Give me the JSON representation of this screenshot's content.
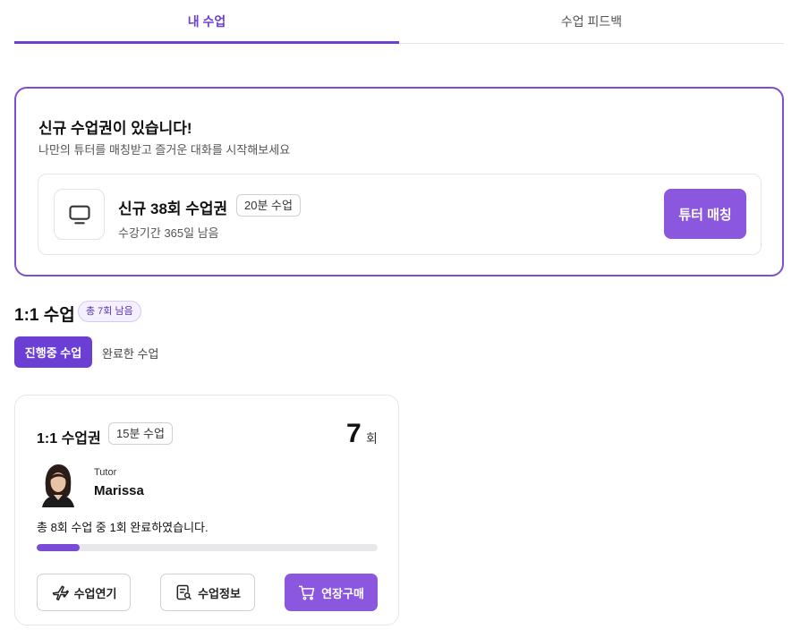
{
  "tabs": [
    {
      "label": "내 수업",
      "active": true
    },
    {
      "label": "수업 피드백",
      "active": false
    }
  ],
  "promo": {
    "title": "신규 수업권이 있습니다!",
    "subtitle": "나만의 튜터를 매칭받고 즐거운 대화를 시작해보세요",
    "ticket": {
      "icon": "monitor-icon",
      "title": "신규 38회 수업권",
      "badge": "20분 수업",
      "subtitle": "수강기간 365일 남음",
      "button": "튜터 매칭"
    }
  },
  "section": {
    "title": "1:1 수업",
    "badge": "총 7회 남음"
  },
  "segments": {
    "active": "진행중 수업",
    "inactive": "완료한 수업"
  },
  "card": {
    "title": "1:1 수업권",
    "badge": "15분 수업",
    "count": "7",
    "count_unit": "회",
    "tutor_label": "Tutor",
    "tutor_name": "Marissa",
    "progress_text": "총 8회 수업 중 1회 완료하였습니다.",
    "progress_fraction": 0.125,
    "buttons": [
      {
        "label": "수업연기",
        "icon": "airplane-icon"
      },
      {
        "label": "수업정보",
        "icon": "document-search-icon"
      },
      {
        "label": "연장구매",
        "icon": "cart-icon"
      }
    ]
  },
  "colors": {
    "accent": "#6b3fd4",
    "button": "#8a57de"
  }
}
